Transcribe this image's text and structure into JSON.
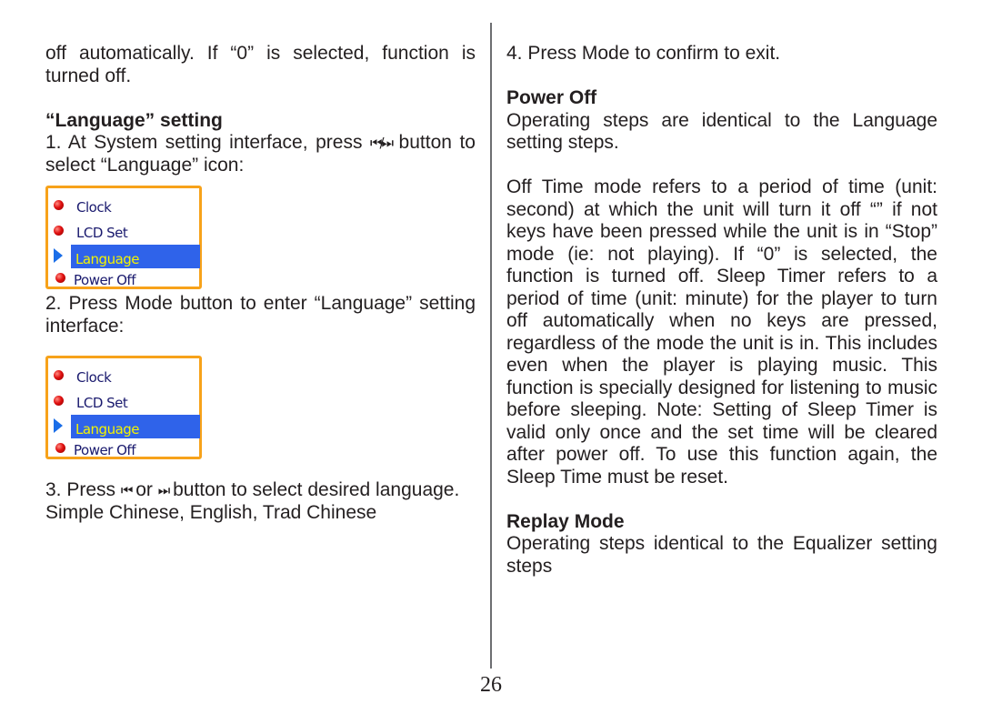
{
  "left_column": {
    "intro_text": "off automatically. If “0”  is selected, function is turned off.",
    "language_heading": "“Language” setting",
    "step1_prefix": "1. At System setting interface, press ",
    "step1_suffix": " button to select “Language”  icon:",
    "step1_button_glyph": "⏮/⏭",
    "menu1": {
      "items": [
        {
          "label": "Clock",
          "icon": "red-bullet"
        },
        {
          "label": "LCD Set",
          "icon": "red-bullet"
        },
        {
          "label": "Language",
          "icon": "blue-arrow",
          "selected": true
        },
        {
          "label": "Power Off",
          "icon": "red-bullet"
        }
      ]
    },
    "step2": "2. Press Mode button to enter “Language” setting interface:",
    "menu2": {
      "items": [
        {
          "label": "Clock",
          "icon": "red-bullet"
        },
        {
          "label": "LCD Set",
          "icon": "red-bullet"
        },
        {
          "label": "Language",
          "icon": "blue-arrow",
          "selected": true
        },
        {
          "label": "Power Off",
          "icon": "red-bullet"
        }
      ]
    },
    "step3_prefix": "3. Press ",
    "step3_prev_glyph": "⏮",
    "step3_mid": " or ",
    "step3_next_glyph": "⏭",
    "step3_suffix": " button to select desired language.",
    "languages": "Simple Chinese, English, Trad Chinese"
  },
  "right_column": {
    "step4": "4. Press Mode to confirm to exit.",
    "power_off_heading": "Power Off",
    "power_off_text": "Operating steps are identical to the Language setting steps.",
    "off_time_text": "Off Time mode refers to a period of time (unit: second) at which the unit will turn it off “” if not keys have been pressed while the unit is in “Stop”  mode (ie: not playing).  If “0” is selected, the function is turned off.  Sleep Timer refers to a period of time (unit: minute) for the player to turn off  automatically when no keys are pressed, regardless of the mode the unit is in.  This includes even when the player is playing music. This function is specially designed for listening to music before sleeping. Note: Setting of Sleep Timer is valid only once and the set time will be cleared after power off. To use this function again, the Sleep Time must be reset.",
    "replay_heading": "Replay Mode",
    "replay_text": "Operating steps identical to the Equalizer setting steps"
  },
  "page_number": "26",
  "colors": {
    "text": "#231f20",
    "menu_border": "#f7a21a",
    "menu_highlight": "#2f63ea",
    "menu_highlight_text": "#f4f400",
    "menu_text": "#1a1a6e",
    "divider": "#6d6e71"
  }
}
